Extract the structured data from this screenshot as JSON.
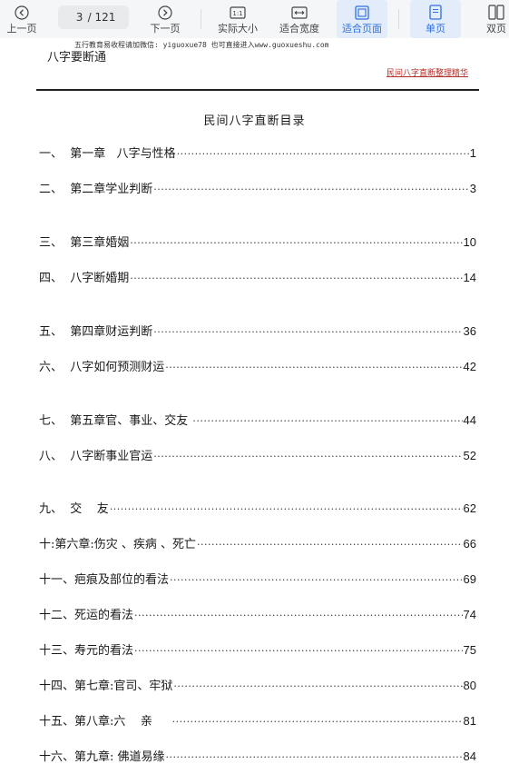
{
  "toolbar": {
    "prev_label": "上一页",
    "page_current": "3",
    "page_total": "/ 121",
    "next_label": "下一页",
    "actual_size_label": "实际大小",
    "actual_size_glyph": "1:1",
    "fit_width_label": "适合宽度",
    "fit_page_label": "适合页面",
    "single_page_label": "单页",
    "double_page_label": "双页"
  },
  "page": {
    "top_note": "五行教育易收程请加微信: yiguoxue78  也可直接进入www.guoxueshu.com",
    "running_head": "八字要断通",
    "series_label": "民间八字直断整理精华",
    "title": "民间八字直断目录",
    "entries": [
      {
        "num": "一、",
        "title": "  第一章   八字与性格",
        "page": "1"
      },
      {
        "num": "二、",
        "title": "  第二章学业判断",
        "page": "3"
      },
      {
        "num": "三、",
        "title": "  第三章婚姻",
        "page": "10"
      },
      {
        "num": "四、",
        "title": "  八字断婚期",
        "page": "14"
      },
      {
        "num": "五、",
        "title": "  第四章财运判断",
        "page": "36"
      },
      {
        "num": "六、",
        "title": "  八字如何预测财运",
        "page": "42"
      },
      {
        "num": "七、",
        "title": "  第五章官、事业、交友 ",
        "page": "44"
      },
      {
        "num": "八、",
        "title": "  八字断事业官运",
        "page": "52"
      },
      {
        "num": "九、",
        "title": "  交    友",
        "page": "62"
      },
      {
        "num": "十:",
        "title": "第六章:伤灾 、疾病 、死亡",
        "page": "66"
      },
      {
        "num": "十一、",
        "title": "疤痕及部位的看法",
        "page": "69"
      },
      {
        "num": "十二、",
        "title": "死运的看法",
        "page": "74"
      },
      {
        "num": "十三、",
        "title": "寿元的看法",
        "page": "75"
      },
      {
        "num": "十四、",
        "title": "第七章:官司、牢狱",
        "page": "80"
      },
      {
        "num": "十五、",
        "title": "第八章:六    亲     ",
        "page": "81"
      },
      {
        "num": "十六、",
        "title": "第九章: 佛道易缘",
        "page": "84"
      }
    ]
  }
}
